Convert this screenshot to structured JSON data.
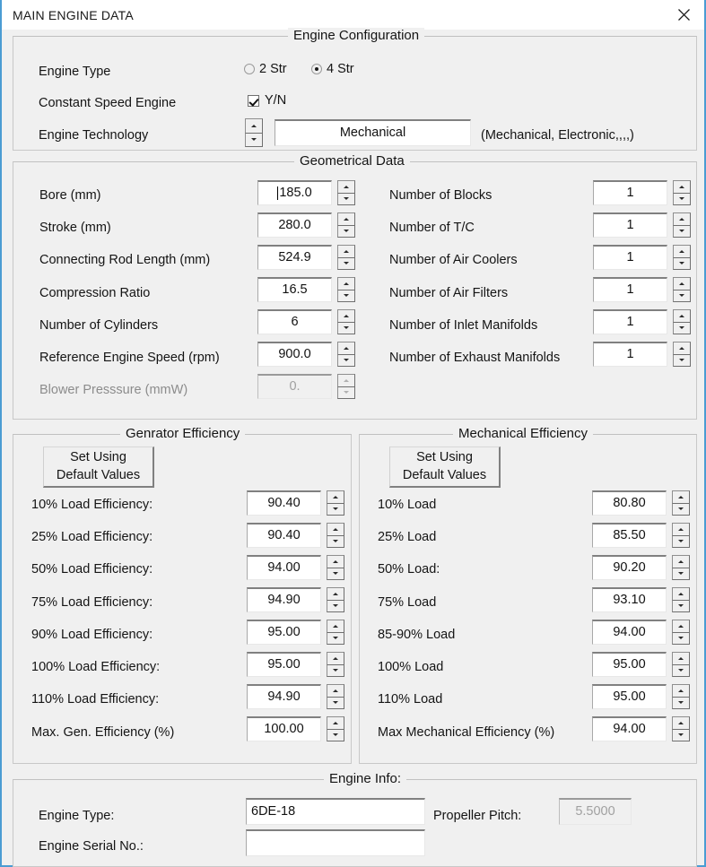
{
  "window": {
    "title": "MAIN ENGINE DATA",
    "close_icon": "close-icon"
  },
  "engine_configuration": {
    "legend": "Engine Configuration",
    "engine_type_label": "Engine Type",
    "radio_2str": "2 Str",
    "radio_4str": "4 Str",
    "selected_stroke": "4 Str",
    "constant_speed_label": "Constant Speed Engine",
    "constant_speed_checkbox_text": "Y/N",
    "constant_speed_checked": true,
    "engine_technology_label": "Engine Technology",
    "engine_technology_value": "Mechanical",
    "engine_technology_hint": "(Mechanical, Electronic,,,,)"
  },
  "geometrical_data": {
    "legend": "Geometrical Data",
    "left_rows": [
      {
        "label": "Bore (mm)",
        "value": "185.0",
        "disabled": false,
        "caret": true
      },
      {
        "label": "Stroke (mm)",
        "value": "280.0",
        "disabled": false,
        "caret": false
      },
      {
        "label": "Connecting Rod Length (mm)",
        "value": "524.9",
        "disabled": false,
        "caret": false
      },
      {
        "label": "Compression Ratio",
        "value": "16.5",
        "disabled": false,
        "caret": false
      },
      {
        "label": "Number of Cylinders",
        "value": "6",
        "disabled": false,
        "caret": false
      },
      {
        "label": "Reference Engine Speed (rpm)",
        "value": "900.0",
        "disabled": false,
        "caret": false
      },
      {
        "label": "Blower Presssure (mmW)",
        "value": "0.",
        "disabled": true,
        "caret": false
      }
    ],
    "right_rows": [
      {
        "label": "Number of Blocks",
        "value": "1"
      },
      {
        "label": "Number of T/C",
        "value": "1"
      },
      {
        "label": "Number of Air Coolers",
        "value": "1"
      },
      {
        "label": "Number of Air Filters",
        "value": "1"
      },
      {
        "label": "Number of Inlet Manifolds",
        "value": "1"
      },
      {
        "label": "Number of Exhaust  Manifolds",
        "value": "1"
      }
    ]
  },
  "generator_efficiency": {
    "legend": "Genrator Efficiency",
    "default_button_line1": "Set Using",
    "default_button_line2": "Default Values",
    "rows": [
      {
        "label": "10% Load Efficiency:",
        "value": "90.40"
      },
      {
        "label": "25% Load Efficiency:",
        "value": "90.40"
      },
      {
        "label": "50% Load Efficiency:",
        "value": "94.00"
      },
      {
        "label": "75% Load Efficiency:",
        "value": "94.90"
      },
      {
        "label": "90% Load Efficiency:",
        "value": "95.00"
      },
      {
        "label": "100% Load Efficiency:",
        "value": "95.00"
      },
      {
        "label": "110% Load Efficiency:",
        "value": "94.90"
      },
      {
        "label": "Max. Gen. Efficiency (%)",
        "value": "100.00"
      }
    ]
  },
  "mechanical_efficiency": {
    "legend": "Mechanical Efficiency",
    "default_button_line1": "Set Using",
    "default_button_line2": "Default Values",
    "rows": [
      {
        "label": "10% Load",
        "value": "80.80"
      },
      {
        "label": "25% Load",
        "value": "85.50"
      },
      {
        "label": "50% Load:",
        "value": "90.20"
      },
      {
        "label": "75% Load",
        "value": "93.10"
      },
      {
        "label": "85-90% Load",
        "value": "94.00"
      },
      {
        "label": "100% Load",
        "value": "95.00"
      },
      {
        "label": "110% Load",
        "value": "95.00"
      },
      {
        "label": "Max Mechanical Efficiency (%)",
        "value": "94.00"
      }
    ]
  },
  "engine_info": {
    "legend": "Engine Info:",
    "engine_type_label": "Engine Type:",
    "engine_type_value": "6DE-18",
    "engine_serial_label": "Engine Serial No.:",
    "engine_serial_value": "",
    "engine_serial_placeholder": "",
    "propeller_pitch_label": "Propeller Pitch:",
    "propeller_pitch_value": "5.5000"
  },
  "colors": {
    "window_border": "#4b9cd3",
    "dialog_bg": "#f0f0f0",
    "field_bg": "#ffffff",
    "disabled_text": "#a0a0a0",
    "text": "#141414"
  }
}
